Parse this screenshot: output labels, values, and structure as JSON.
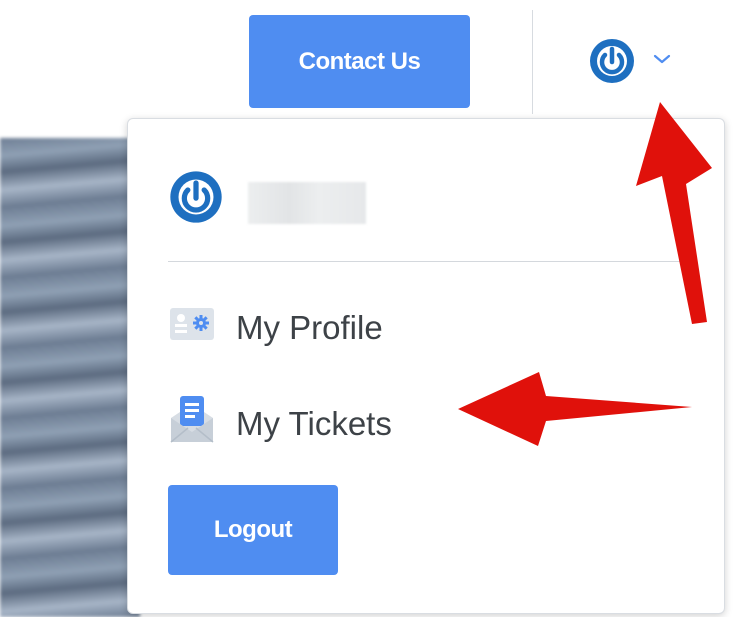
{
  "header": {
    "contact_label": "Contact Us",
    "user_icon": "power-icon",
    "dropdown_icon": "chevron-down-icon"
  },
  "dropdown": {
    "user_name": "",
    "items": [
      {
        "label": "My Profile",
        "icon": "profile-card-icon"
      },
      {
        "label": "My Tickets",
        "icon": "ticket-envelope-icon"
      }
    ],
    "logout_label": "Logout"
  },
  "colors": {
    "primary": "#4f8df1",
    "icon_blue": "#1e6fc0",
    "annotation_red": "#e0110b"
  }
}
